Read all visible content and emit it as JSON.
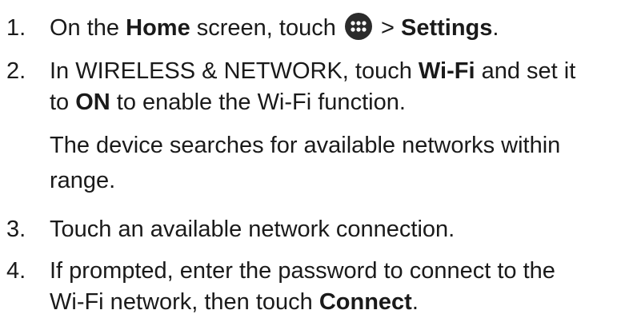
{
  "steps": [
    {
      "number": "1.",
      "line1": {
        "t1": "On the ",
        "b1": "Home",
        "t2": " screen, touch ",
        "icon": "apps-grid-icon",
        "t3": " > ",
        "b2": "Settings",
        "t4": "."
      }
    },
    {
      "number": "2.",
      "line1": {
        "t1": "In WIRELESS & NETWORK, touch ",
        "b1": "Wi-Fi",
        "t2": " and set it"
      },
      "line2": {
        "t1": "to ",
        "b1": "ON",
        "t2": " to enable the Wi-Fi function."
      },
      "para_line1": "The device searches for available networks within",
      "para_line2": "range."
    },
    {
      "number": "3.",
      "line1": "Touch an available network connection."
    },
    {
      "number": "4.",
      "line1": "If prompted, enter the password to connect to the",
      "line2": {
        "t1": "Wi-Fi network, then touch ",
        "b1": "Connect",
        "t2": "."
      }
    }
  ]
}
